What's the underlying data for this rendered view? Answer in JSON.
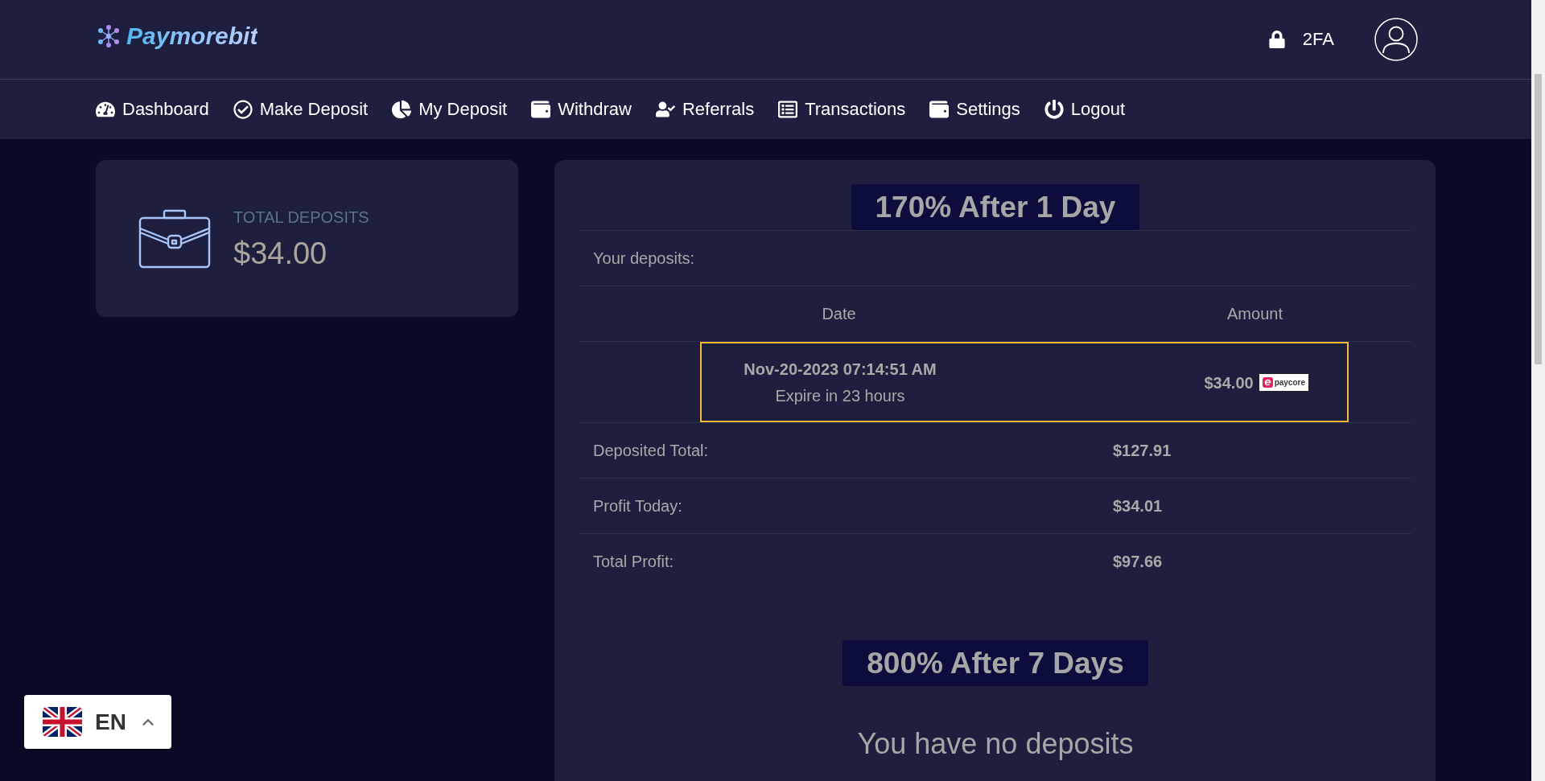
{
  "header": {
    "logo": "Paymorebit",
    "two_factor": "2FA"
  },
  "nav": [
    "Dashboard",
    "Make Deposit",
    "My Deposit",
    "Withdraw",
    "Referrals",
    "Transactions",
    "Settings",
    "Logout"
  ],
  "summary_card": {
    "label": "TOTAL DEPOSITS",
    "value": "$34.00"
  },
  "plans": [
    {
      "kind": "table",
      "title": "170% After 1 Day",
      "deposits_label": "Your deposits:",
      "columns": [
        "Date",
        "Amount"
      ],
      "deposits": [
        {
          "date": "Nov-20-2023 07:14:51 AM",
          "expiry": "Expire in 23 hours",
          "amount": "$34.00",
          "method": "paycore",
          "highlighted": true
        }
      ],
      "totals": [
        {
          "label": "Deposited Total:",
          "value": "$127.91"
        },
        {
          "label": "Profit Today:",
          "value": "$34.01"
        },
        {
          "label": "Total Profit:",
          "value": "$97.66"
        }
      ]
    },
    {
      "kind": "empty",
      "title": "800% After 7 Days",
      "message": "You have no deposits"
    }
  ],
  "language": {
    "code": "EN"
  }
}
